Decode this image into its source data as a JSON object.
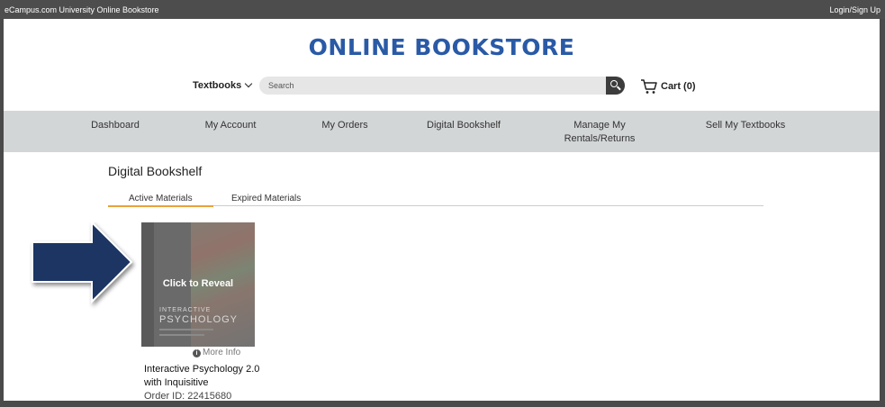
{
  "topbar": {
    "site_name": "eCampus.com University Online Bookstore",
    "login_label": "Login/Sign Up"
  },
  "header": {
    "brand": "ONLINE BOOKSTORE",
    "textbooks_label": "Textbooks",
    "search_placeholder": "Search",
    "cart_label": "Cart (0)",
    "icons": {
      "search": "search-icon",
      "cart": "cart-icon",
      "chevron": "chevron-down-icon"
    }
  },
  "nav": {
    "items": [
      {
        "label": "Dashboard"
      },
      {
        "label": "My Account"
      },
      {
        "label": "My Orders"
      },
      {
        "label": "Digital Bookshelf"
      },
      {
        "label": "Manage My",
        "label2": "Rentals/Returns"
      },
      {
        "label": "Sell My Textbooks"
      }
    ]
  },
  "main": {
    "heading": "Digital Bookshelf",
    "tabs": [
      {
        "label": "Active Materials",
        "active": true
      },
      {
        "label": "Expired Materials",
        "active": false
      }
    ],
    "book": {
      "overlay": "Click to Reveal",
      "cover_line1": "INTERACTIVE",
      "cover_line2": "PSYCHOLOGY",
      "more_info": "More Info",
      "title": "Interactive Psychology 2.0 with Inquisitive",
      "order_id": "Order ID: 22415680"
    }
  },
  "colors": {
    "brand": "#2a5aa6",
    "nav_bg": "#d3d6d7",
    "tab_accent": "#e8a23a",
    "arrow": "#1f3563"
  }
}
